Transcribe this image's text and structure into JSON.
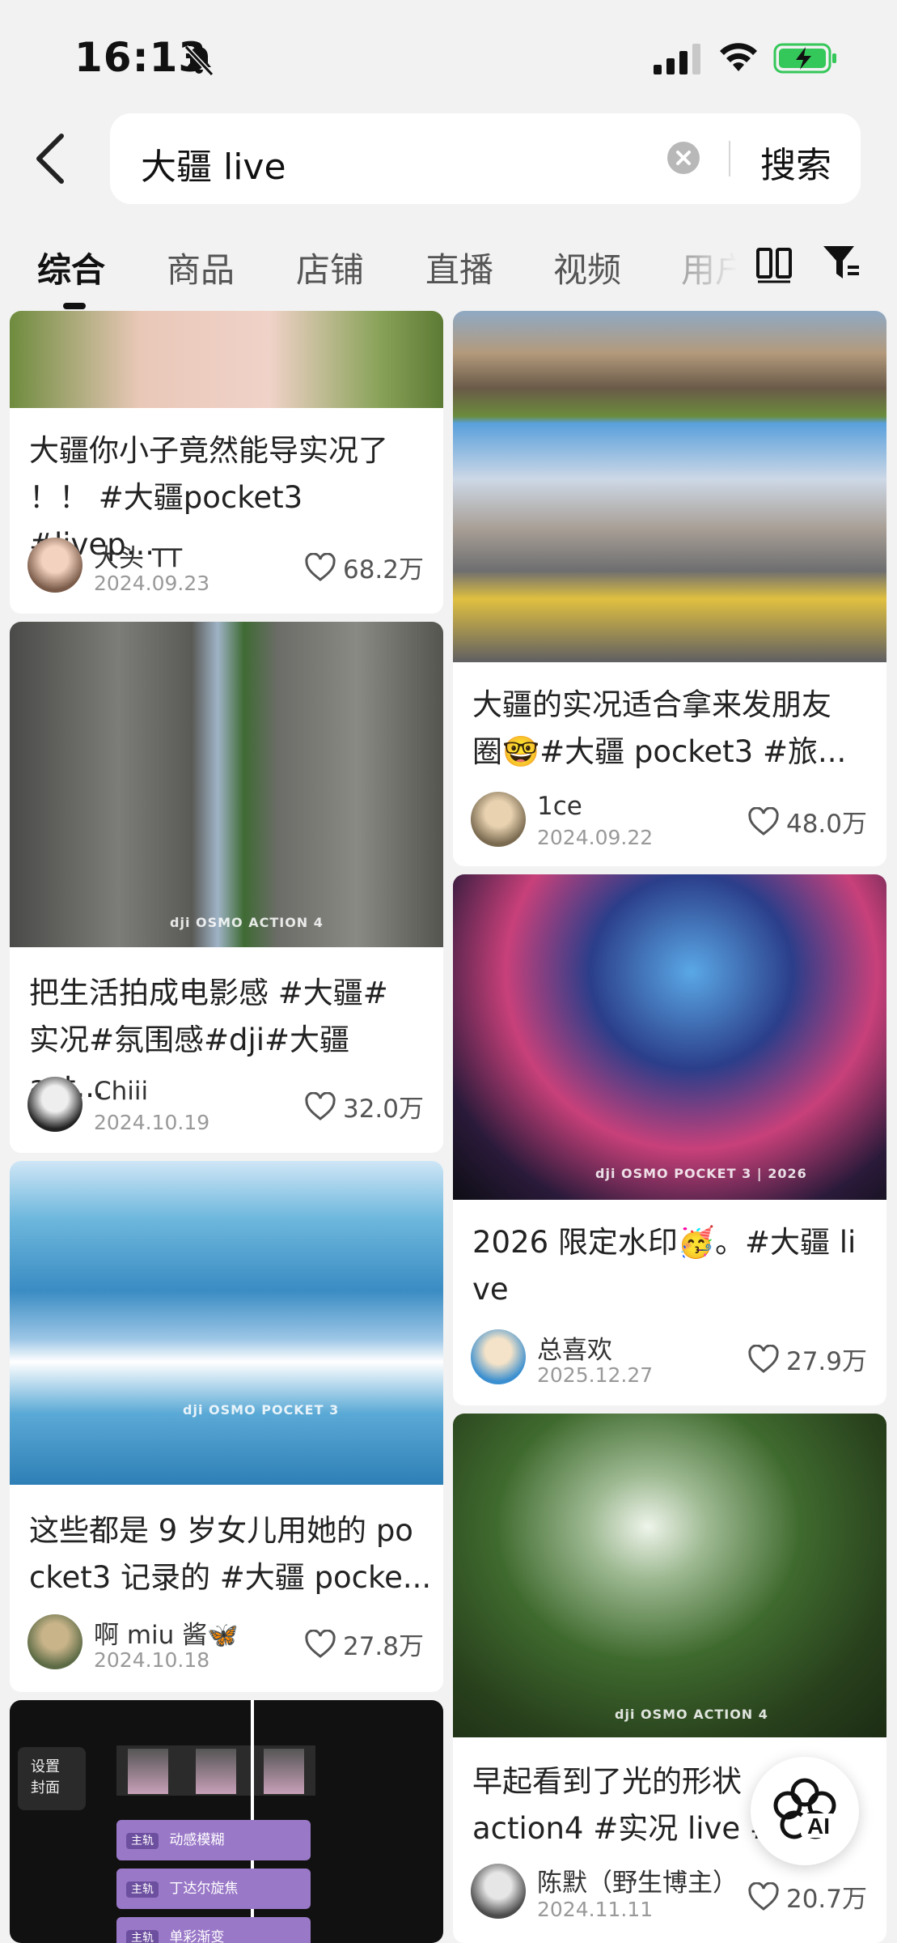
{
  "status": {
    "time": "16:13"
  },
  "search": {
    "query": "大疆 live",
    "button": "搜索"
  },
  "tabs": [
    "综合",
    "商品",
    "店铺",
    "直播",
    "视频",
    "用户"
  ],
  "colors": {
    "background": "#f2f2f2",
    "card": "#ffffff",
    "battery": "#34c759"
  },
  "cards": [
    {
      "title_l1": "大疆你小子竟然能导实况了",
      "title_l2": "！！ #大疆pocket3 #livep...",
      "author": "大头 TT",
      "date": "2024.09.23",
      "likes": "68.2万"
    },
    {
      "title_l1": "大疆的实况适合拿来发朋友",
      "title_l2": "圈🤓#大疆 pocket3 #旅...",
      "author": "1ce",
      "date": "2024.09.22",
      "likes": "48.0万"
    },
    {
      "title_l1": "把生活拍成电影感 #大疆#",
      "title_l2": "实况#氛围感#dji#大疆 act...",
      "author": "Chiii",
      "date": "2024.10.19",
      "likes": "32.0万",
      "watermark": "dji OSMO ACTION 4"
    },
    {
      "title_l1": "2026 限定水印🥳。#大疆 li",
      "title_l2": "ve",
      "author": "总喜欢",
      "date": "2025.12.27",
      "likes": "27.9万",
      "watermark": "dji OSMO POCKET 3 | 2026"
    },
    {
      "title_l1": "这些都是 9 岁女儿用她的 po",
      "title_l2": "cket3 记录的 #大疆 pocke...",
      "author": "啊 miu 酱🦋",
      "date": "2024.10.18",
      "likes": "27.8万",
      "watermark": "dji OSMO POCKET 3"
    },
    {
      "title_l1": "早起看到了光的形状",
      "title_l2": "action4 #实况 live #",
      "author": "陈默（野生博主）",
      "date": "2024.11.11",
      "likes": "20.7万",
      "watermark": "dji OSMO ACTION 4"
    }
  ],
  "editor_card": {
    "cover_label_l1": "设置",
    "cover_label_l2": "封面",
    "tracks": [
      {
        "tag": "主轨",
        "name": "动感模糊"
      },
      {
        "tag": "主轨",
        "name": "丁达尔旋焦"
      },
      {
        "tag": "主轨",
        "name": "单彩渐变"
      }
    ]
  }
}
